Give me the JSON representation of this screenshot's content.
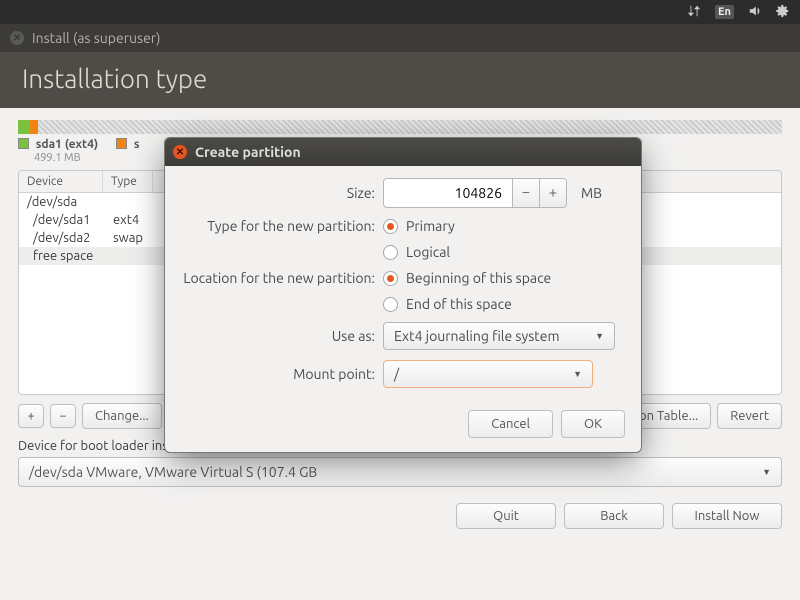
{
  "panel": {
    "lang": "En"
  },
  "window": {
    "title": "Install (as superuser)"
  },
  "page": {
    "title": "Installation type"
  },
  "legend": {
    "items": [
      {
        "label": "sda1 (ext4)",
        "sub": "499.1 MB",
        "color": "#7cc040"
      },
      {
        "label": "s",
        "sub": "",
        "color": "#f28412"
      }
    ]
  },
  "table": {
    "headers": [
      "Device",
      "Type"
    ],
    "rows": [
      {
        "device": "/dev/sda",
        "type": "",
        "indent": 0,
        "selected": false
      },
      {
        "device": "/dev/sda1",
        "type": "ext4",
        "indent": 1,
        "selected": false
      },
      {
        "device": "/dev/sda2",
        "type": "swap",
        "indent": 1,
        "selected": false
      },
      {
        "device": "free space",
        "type": "",
        "indent": 1,
        "selected": true
      }
    ]
  },
  "toolbar": {
    "add": "+",
    "remove": "−",
    "change": "Change...",
    "new_table": "New Partition Table...",
    "revert": "Revert"
  },
  "boot": {
    "label": "Device for boot loader installation:",
    "value": "/dev/sda   VMware, VMware Virtual S (107.4 GB"
  },
  "footer": {
    "quit": "Quit",
    "back": "Back",
    "install": "Install Now"
  },
  "dialog": {
    "title": "Create partition",
    "size_label": "Size:",
    "size_value": "104826",
    "size_unit": "MB",
    "type_label": "Type for the new partition:",
    "type_primary": "Primary",
    "type_logical": "Logical",
    "loc_label": "Location for the new partition:",
    "loc_begin": "Beginning of this space",
    "loc_end": "End of this space",
    "use_as_label": "Use as:",
    "use_as_value": "Ext4 journaling file system",
    "mount_label": "Mount point:",
    "mount_value": "/",
    "cancel": "Cancel",
    "ok": "OK"
  }
}
